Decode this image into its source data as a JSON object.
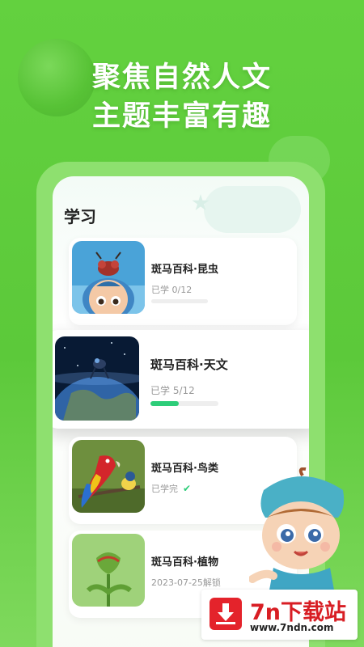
{
  "headline": {
    "line1": "聚焦自然人文",
    "line2": "主题丰富有趣"
  },
  "section_title": "学习",
  "courses": [
    {
      "title": "斑马百科·昆虫",
      "status": "已学 0/12",
      "progress": 0.0
    },
    {
      "title": "斑马百科·天文",
      "status": "已学 5/12",
      "progress": 0.4167
    },
    {
      "title": "斑马百科·鸟类",
      "status": "已学完",
      "completed_icon": "check-icon"
    },
    {
      "title": "斑马百科·植物",
      "status": "2023-07-25解锁"
    }
  ],
  "watermark": {
    "title": "7n下载站",
    "url": "www.7ndn.com"
  },
  "colors": {
    "background": "#5cc93a",
    "progress": "#2dcd79",
    "watermark_red": "#d81e24"
  }
}
